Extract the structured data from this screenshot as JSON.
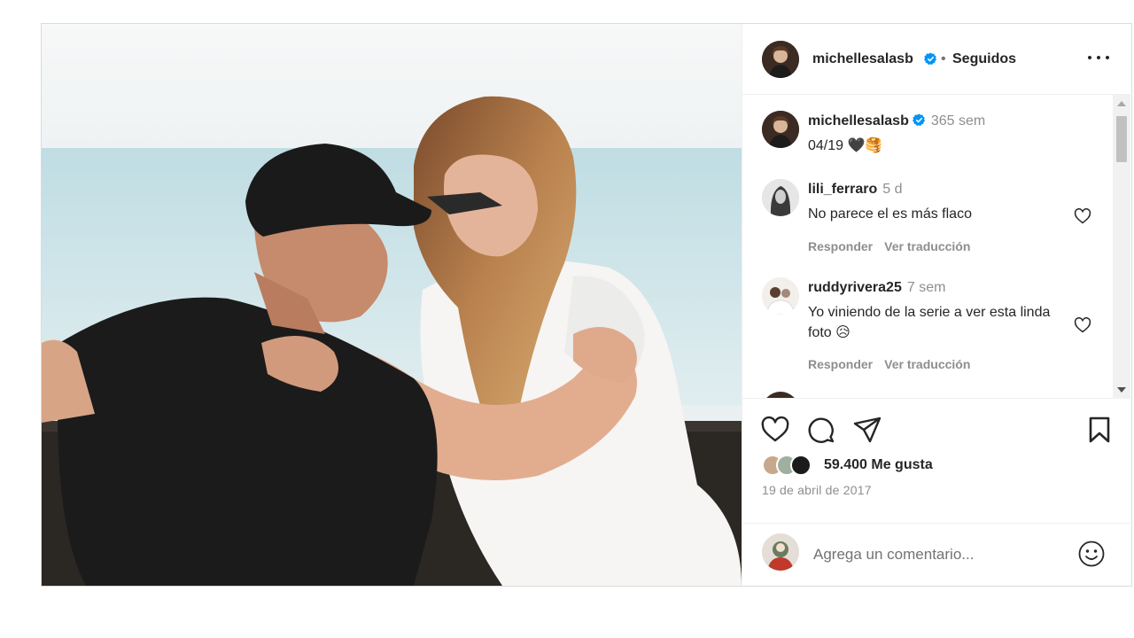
{
  "post": {
    "author": "michellesalasb",
    "verified": true,
    "separator": "•",
    "follow_status": "Seguidos",
    "image_alt": "Foto de la publicación"
  },
  "caption": {
    "username": "michellesalasb",
    "time": "365 sem",
    "text": "04/19 🖤🥞"
  },
  "comments": [
    {
      "username": "lili_ferraro",
      "time": "5 d",
      "text": "No parece el es más flaco",
      "reply_label": "Responder",
      "translate_label": "Ver traducción"
    },
    {
      "username": "ruddyrivera25",
      "time": "7 sem",
      "text": "Yo viniendo de la serie a ver esta linda foto 😥",
      "reply_label": "Responder",
      "translate_label": "Ver traducción"
    }
  ],
  "actions": {
    "like_icon": "heart-icon",
    "comment_icon": "comment-icon",
    "share_icon": "share-icon",
    "save_icon": "bookmark-icon"
  },
  "likes": {
    "count_label": "59.400 Me gusta"
  },
  "date": "19 de abril de 2017",
  "add_comment": {
    "placeholder": "Agrega un comentario..."
  },
  "colors": {
    "verified": "#0095f6",
    "text": "#262626",
    "secondary": "#8e8e8e",
    "border": "#dbdbdb"
  }
}
